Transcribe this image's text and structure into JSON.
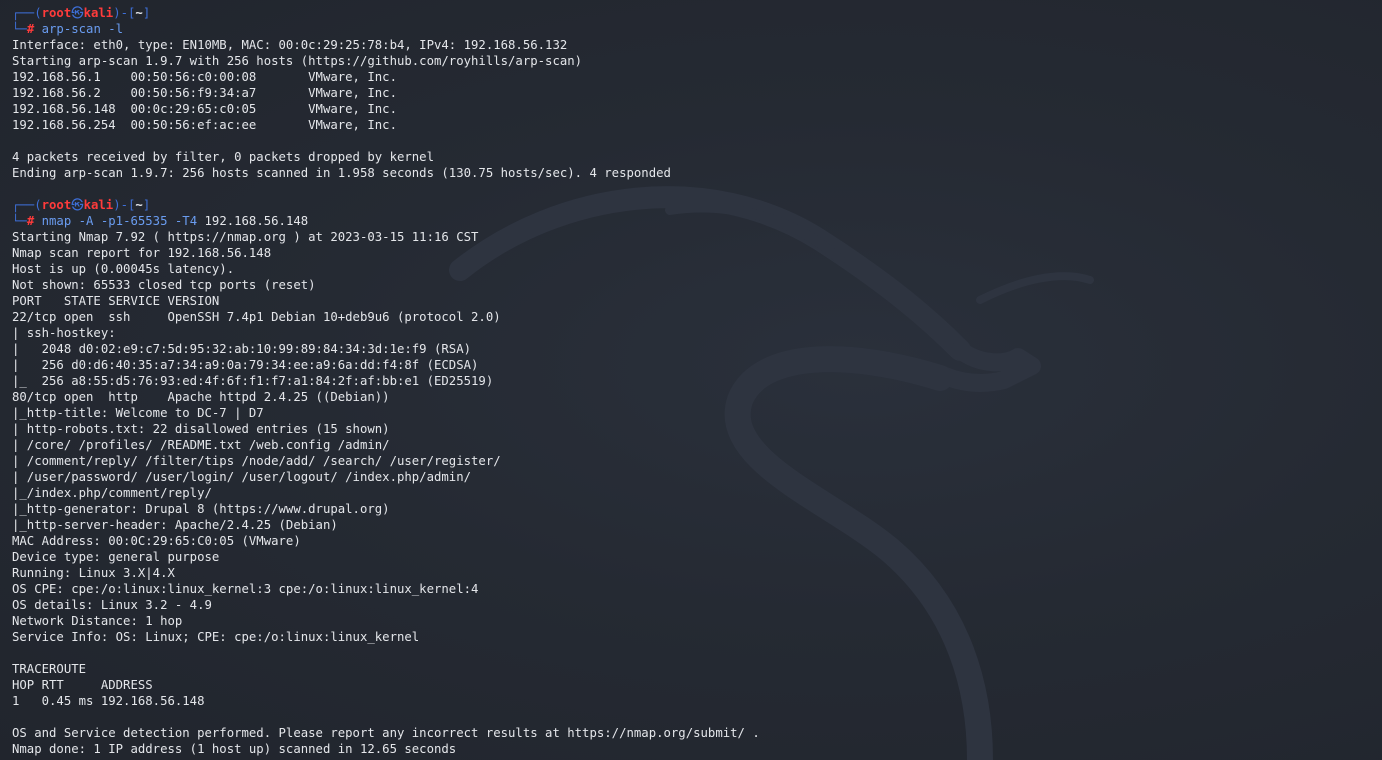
{
  "terminal": {
    "sessions": [
      {
        "prompt": {
          "open": "┌──(",
          "user": "root",
          "at": "㉿",
          "host": "kali",
          "close": ")-[",
          "path": "~",
          "end": "]"
        },
        "command": {
          "corner": "└─",
          "hash": "#",
          "program": "arp-scan",
          "args": " -l",
          "target": ""
        },
        "output": [
          "Interface: eth0, type: EN10MB, MAC: 00:0c:29:25:78:b4, IPv4: 192.168.56.132",
          "Starting arp-scan 1.9.7 with 256 hosts (https://github.com/royhills/arp-scan)",
          "192.168.56.1    00:50:56:c0:00:08       VMware, Inc.",
          "192.168.56.2    00:50:56:f9:34:a7       VMware, Inc.",
          "192.168.56.148  00:0c:29:65:c0:05       VMware, Inc.",
          "192.168.56.254  00:50:56:ef:ac:ee       VMware, Inc.",
          "",
          "4 packets received by filter, 0 packets dropped by kernel",
          "Ending arp-scan 1.9.7: 256 hosts scanned in 1.958 seconds (130.75 hosts/sec). 4 responded",
          ""
        ]
      },
      {
        "prompt": {
          "open": "┌──(",
          "user": "root",
          "at": "㉿",
          "host": "kali",
          "close": ")-[",
          "path": "~",
          "end": "]"
        },
        "command": {
          "corner": "└─",
          "hash": "#",
          "program": "nmap",
          "args": " -A -p1-65535 -T4",
          "target": " 192.168.56.148"
        },
        "output": [
          "Starting Nmap 7.92 ( https://nmap.org ) at 2023-03-15 11:16 CST",
          "Nmap scan report for 192.168.56.148",
          "Host is up (0.00045s latency).",
          "Not shown: 65533 closed tcp ports (reset)",
          "PORT   STATE SERVICE VERSION",
          "22/tcp open  ssh     OpenSSH 7.4p1 Debian 10+deb9u6 (protocol 2.0)",
          "| ssh-hostkey: ",
          "|   2048 d0:02:e9:c7:5d:95:32:ab:10:99:89:84:34:3d:1e:f9 (RSA)",
          "|   256 d0:d6:40:35:a7:34:a9:0a:79:34:ee:a9:6a:dd:f4:8f (ECDSA)",
          "|_  256 a8:55:d5:76:93:ed:4f:6f:f1:f7:a1:84:2f:af:bb:e1 (ED25519)",
          "80/tcp open  http    Apache httpd 2.4.25 ((Debian))",
          "|_http-title: Welcome to DC-7 | D7",
          "| http-robots.txt: 22 disallowed entries (15 shown)",
          "| /core/ /profiles/ /README.txt /web.config /admin/ ",
          "| /comment/reply/ /filter/tips /node/add/ /search/ /user/register/ ",
          "| /user/password/ /user/login/ /user/logout/ /index.php/admin/ ",
          "|_/index.php/comment/reply/",
          "|_http-generator: Drupal 8 (https://www.drupal.org)",
          "|_http-server-header: Apache/2.4.25 (Debian)",
          "MAC Address: 00:0C:29:65:C0:05 (VMware)",
          "Device type: general purpose",
          "Running: Linux 3.X|4.X",
          "OS CPE: cpe:/o:linux:linux_kernel:3 cpe:/o:linux:linux_kernel:4",
          "OS details: Linux 3.2 - 4.9",
          "Network Distance: 1 hop",
          "Service Info: OS: Linux; CPE: cpe:/o:linux:linux_kernel",
          "",
          "TRACEROUTE",
          "HOP RTT     ADDRESS",
          "1   0.45 ms 192.168.56.148",
          "",
          "OS and Service detection performed. Please report any incorrect results at https://nmap.org/submit/ .",
          "Nmap done: 1 IP address (1 host up) scanned in 12.65 seconds"
        ]
      }
    ]
  },
  "background": {
    "icon": "kali-dragon-icon",
    "colors": {
      "bg": "#232832",
      "prompt_blue": "#3e6fd8",
      "prompt_red": "#ff3b3b",
      "command_blue": "#6a9cf0",
      "text": "#e4e6ea"
    }
  }
}
